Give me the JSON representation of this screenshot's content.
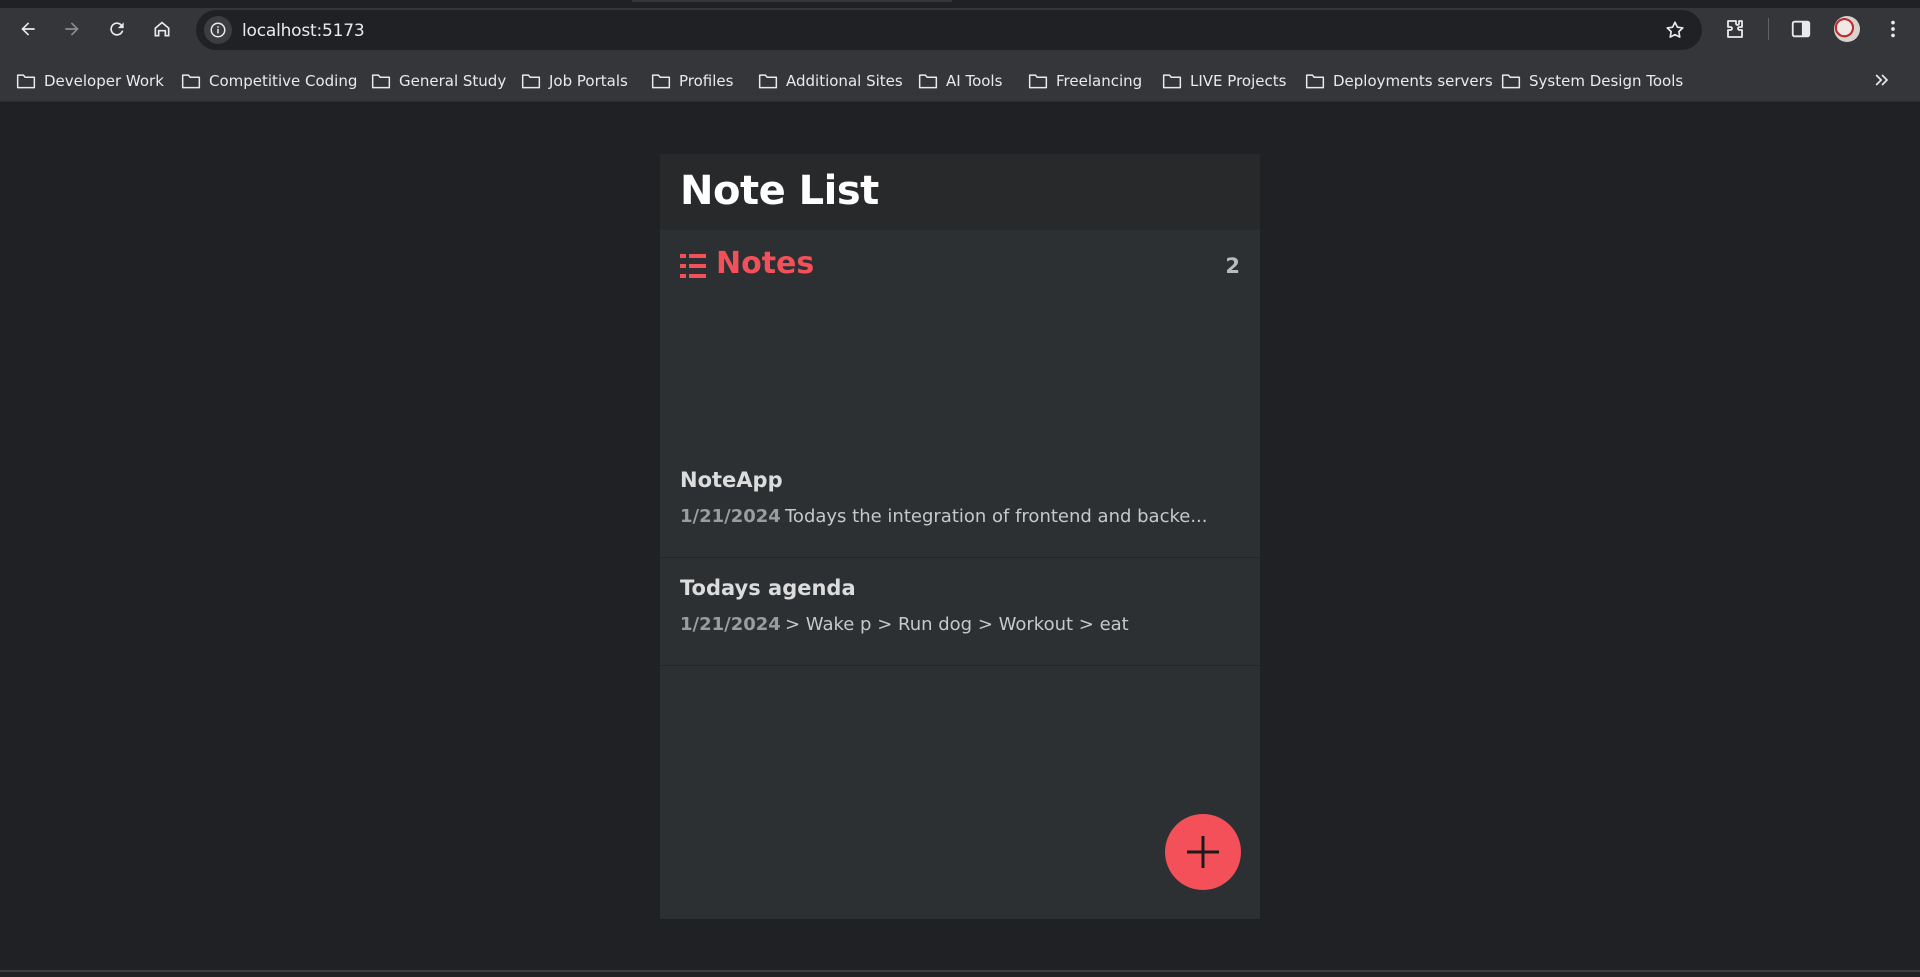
{
  "browser": {
    "url": "localhost:5173",
    "bookmarks": [
      {
        "label": "Developer Work"
      },
      {
        "label": "Competitive Coding"
      },
      {
        "label": "General Study"
      },
      {
        "label": "Job Portals"
      },
      {
        "label": "Profiles"
      },
      {
        "label": "Additional Sites"
      },
      {
        "label": "AI Tools"
      },
      {
        "label": "Freelancing"
      },
      {
        "label": "LIVE Projects"
      },
      {
        "label": "Deployments servers"
      },
      {
        "label": "System Design Tools"
      }
    ]
  },
  "app": {
    "title": "Note List",
    "notes_section": {
      "label": "Notes",
      "count": "2",
      "icon": "list-icon"
    },
    "notes": [
      {
        "title": "NoteApp",
        "date": "1/21/2024",
        "preview": "Todays the integration of frontend and backe..."
      },
      {
        "title": "Todays agenda",
        "date": "1/21/2024",
        "preview": "> Wake p > Run dog > Workout > eat"
      }
    ],
    "fab_icon": "plus-icon"
  },
  "colors": {
    "accent": "#f4505a",
    "background": "#202124",
    "panel": "#2d3033"
  }
}
